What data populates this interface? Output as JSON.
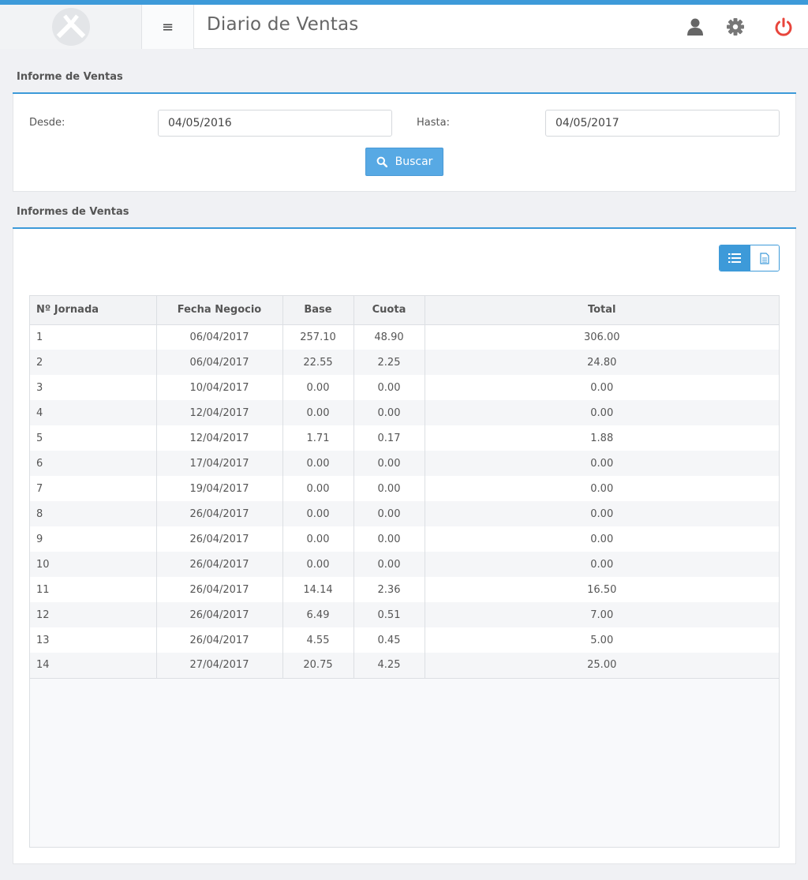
{
  "header": {
    "title": "Diario de Ventas",
    "icons": [
      "logo-icon",
      "hamburger-menu-icon",
      "user-icon",
      "gear-icon",
      "power-icon"
    ],
    "menu_glyph": "≡"
  },
  "search_panel": {
    "title": "Informe de Ventas",
    "desde_label": "Desde:",
    "desde_value": "04/05/2016",
    "hasta_label": "Hasta:",
    "hasta_value": "04/05/2017",
    "search_button": "Buscar"
  },
  "results_panel": {
    "title": "Informes de Ventas",
    "table": {
      "columns": [
        "Nº Jornada",
        "Fecha Negocio",
        "Base",
        "Cuota",
        "Total"
      ],
      "rows": [
        [
          "1",
          "06/04/2017",
          "257.10",
          "48.90",
          "306.00"
        ],
        [
          "2",
          "06/04/2017",
          "22.55",
          "2.25",
          "24.80"
        ],
        [
          "3",
          "10/04/2017",
          "0.00",
          "0.00",
          "0.00"
        ],
        [
          "4",
          "12/04/2017",
          "0.00",
          "0.00",
          "0.00"
        ],
        [
          "5",
          "12/04/2017",
          "1.71",
          "0.17",
          "1.88"
        ],
        [
          "6",
          "17/04/2017",
          "0.00",
          "0.00",
          "0.00"
        ],
        [
          "7",
          "19/04/2017",
          "0.00",
          "0.00",
          "0.00"
        ],
        [
          "8",
          "26/04/2017",
          "0.00",
          "0.00",
          "0.00"
        ],
        [
          "9",
          "26/04/2017",
          "0.00",
          "0.00",
          "0.00"
        ],
        [
          "10",
          "26/04/2017",
          "0.00",
          "0.00",
          "0.00"
        ],
        [
          "11",
          "26/04/2017",
          "14.14",
          "2.36",
          "16.50"
        ],
        [
          "12",
          "26/04/2017",
          "6.49",
          "0.51",
          "7.00"
        ],
        [
          "13",
          "26/04/2017",
          "4.55",
          "0.45",
          "5.00"
        ],
        [
          "14",
          "27/04/2017",
          "20.75",
          "4.25",
          "25.00"
        ]
      ]
    }
  },
  "colors": {
    "accent": "#3d9ad9",
    "button": "#57a9e4",
    "power": "#e8453c",
    "icon": "#666666"
  }
}
